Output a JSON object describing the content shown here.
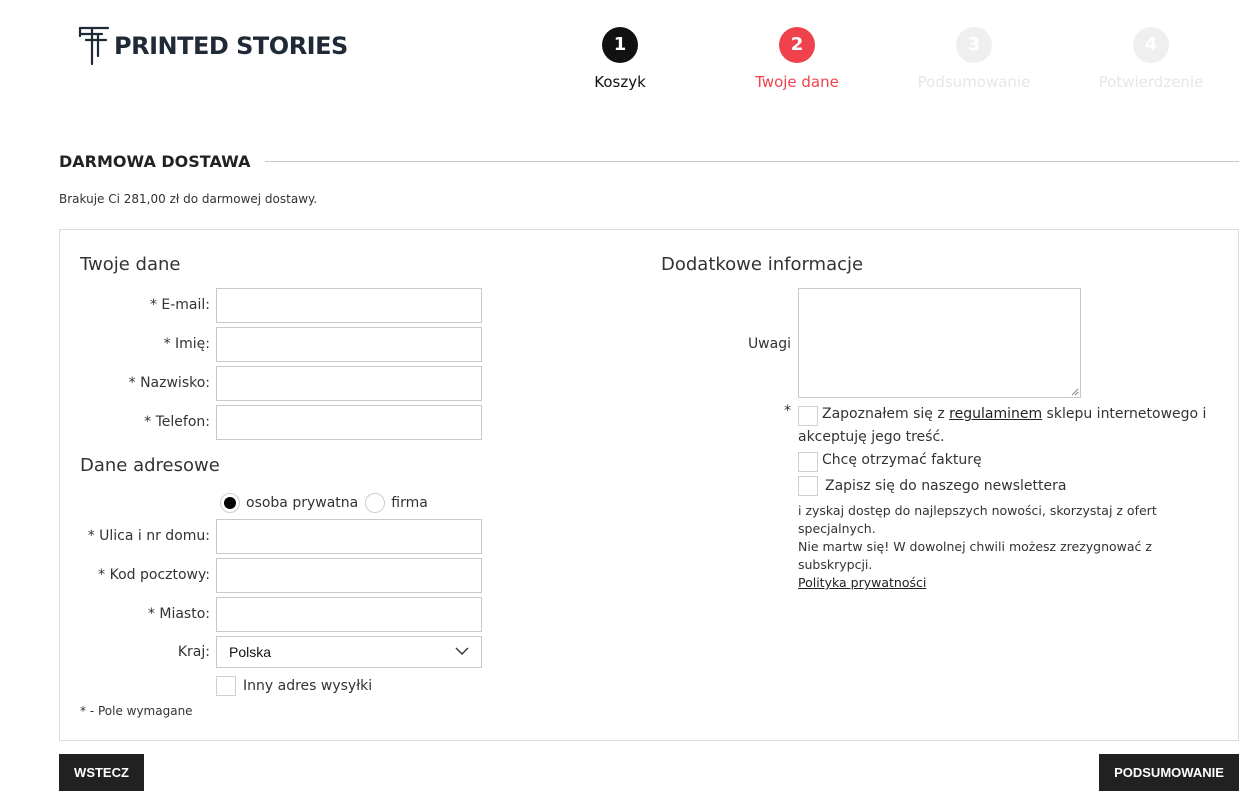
{
  "header": {
    "logo_text": "PRINTED STORIES"
  },
  "steps": [
    {
      "number": "1",
      "label": "Koszyk",
      "state": "done"
    },
    {
      "number": "2",
      "label": "Twoje dane",
      "state": "active"
    },
    {
      "number": "3",
      "label": "Podsumowanie",
      "state": "future"
    },
    {
      "number": "4",
      "label": "Potwierdzenie",
      "state": "future"
    }
  ],
  "free_shipping": {
    "title": "DARMOWA DOSTAWA",
    "info": "Brakuje Ci 281,00 zł do darmowej dostawy."
  },
  "personal": {
    "title": "Twoje dane",
    "email_label": "* E-mail:",
    "email_value": "",
    "first_name_label": "* Imię:",
    "first_name_value": "",
    "last_name_label": "* Nazwisko:",
    "last_name_value": "",
    "phone_label": "* Telefon:",
    "phone_value": ""
  },
  "address": {
    "title": "Dane adresowe",
    "type_private": "osoba prywatna",
    "type_company": "firma",
    "selected_type": "osoba prywatna",
    "street_label": "* Ulica i nr domu:",
    "street_value": "",
    "postal_label": "* Kod pocztowy:",
    "postal_value": "",
    "city_label": "* Miasto:",
    "city_value": "",
    "country_label": "Kraj:",
    "country_value": "Polska",
    "other_address_label": "Inny adres wysyłki",
    "other_address_checked": false
  },
  "required_note": "* - Pole wymagane",
  "additional": {
    "title": "Dodatkowe informacje",
    "notes_label": "Uwagi",
    "notes_value": "",
    "terms_star": "*",
    "terms_text_before": "Zapoznałem się z ",
    "terms_link": "regulaminem",
    "terms_text_after": " sklepu internetowego i",
    "terms_text_line2": "akceptuję jego treść.",
    "terms_checked": false,
    "invoice_label": "Chcę otrzymać fakturę",
    "invoice_checked": false,
    "newsletter_label": "Zapisz się do naszego newslettera",
    "newsletter_checked": false,
    "newsletter_desc_1": "i zyskaj dostęp do najlepszych nowości, skorzystaj z ofert specjalnych.",
    "newsletter_desc_2": "Nie martw się! W dowolnej chwili możesz zrezygnować z subskrypcji.",
    "privacy_link": "Polityka prywatności"
  },
  "buttons": {
    "back": "WSTECZ",
    "next": "PODSUMOWANIE"
  },
  "colors": {
    "accent": "#f0424d",
    "done": "#111111",
    "future": "#efefef",
    "button_bg": "#212121"
  }
}
